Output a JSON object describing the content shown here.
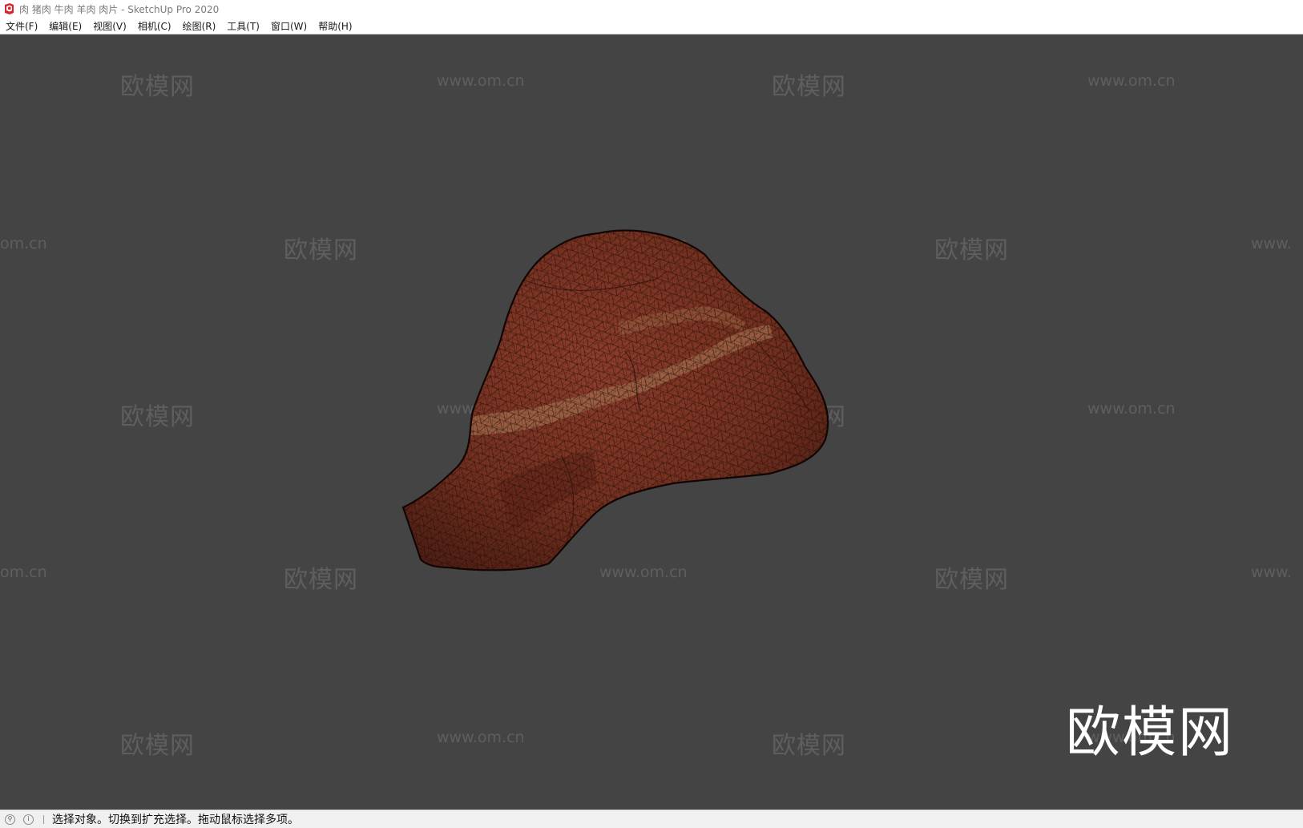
{
  "window": {
    "title": "肉 猪肉 牛肉 羊肉 肉片 - SketchUp Pro 2020",
    "icon": "sketchup-logo-icon"
  },
  "menu": [
    {
      "label": "文件(F)"
    },
    {
      "label": "编辑(E)"
    },
    {
      "label": "视图(V)"
    },
    {
      "label": "相机(C)"
    },
    {
      "label": "绘图(R)"
    },
    {
      "label": "工具(T)"
    },
    {
      "label": "窗口(W)"
    },
    {
      "label": "帮助(H)"
    }
  ],
  "watermark": {
    "brand": "欧模网",
    "url": "www.om.cn",
    "url_partial_left": "om.cn",
    "url_partial_right": "www."
  },
  "status": {
    "icons": [
      "geo-location-icon",
      "info-icon"
    ],
    "message": "选择对象。切换到扩充选择。拖动鼠标选择多项。"
  },
  "colors": {
    "viewport_bg": "#444444",
    "model_fill": "#7a3226",
    "wire": "#1a0b07"
  }
}
